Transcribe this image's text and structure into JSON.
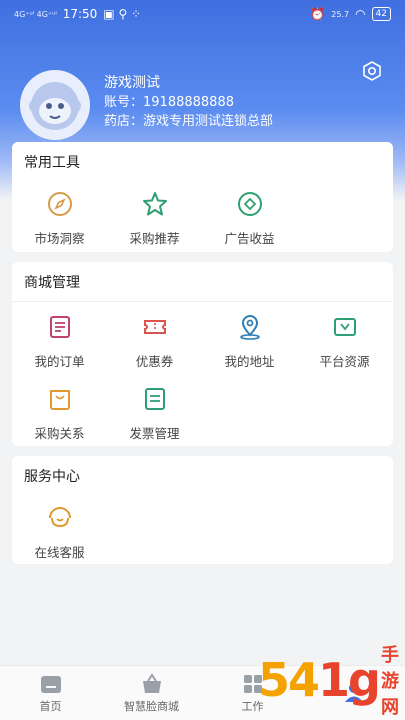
{
  "status_bar": {
    "left_signal": "4G⁺ᵘˡ 4G⁺ᵘˡ",
    "time": "17:50",
    "right_speed": "25.7",
    "battery": "42"
  },
  "profile": {
    "name": "游戏测试",
    "account": "账号：19188888888",
    "store": "药店：游戏专用测试连锁总部"
  },
  "tools": {
    "title": "常用工具",
    "items": [
      {
        "label": "市场洞察",
        "icon": "compass-icon",
        "color": "#d69a4a"
      },
      {
        "label": "采购推荐",
        "icon": "star-icon",
        "color": "#2e9f73"
      },
      {
        "label": "广告收益",
        "icon": "diamond-icon",
        "color": "#2e9f73"
      }
    ]
  },
  "mall": {
    "title": "商城管理",
    "items": [
      {
        "label": "我的订单",
        "icon": "order-icon",
        "color": "#c0436a"
      },
      {
        "label": "优惠券",
        "icon": "coupon-icon",
        "color": "#d9534f"
      },
      {
        "label": "我的地址",
        "icon": "location-icon",
        "color": "#2e7fb8"
      },
      {
        "label": "平台资源",
        "icon": "resource-icon",
        "color": "#2e9f73"
      },
      {
        "label": "采购关系",
        "icon": "bag-icon",
        "color": "#e09a2d"
      },
      {
        "label": "发票管理",
        "icon": "invoice-icon",
        "color": "#2e9f73"
      }
    ]
  },
  "service": {
    "title": "服务中心",
    "items": [
      {
        "label": "在线客服",
        "icon": "chat-icon",
        "color": "#e09a2d"
      }
    ]
  },
  "tabbar": [
    {
      "label": "首页",
      "icon": "home-icon"
    },
    {
      "label": "智慧脸商城",
      "icon": "basket-icon"
    },
    {
      "label": "工作",
      "icon": "grid-icon"
    },
    {
      "label": "",
      "icon": "user-icon"
    }
  ],
  "watermark": {
    "num": "54",
    "num2": "1g",
    "text": "手游网"
  }
}
